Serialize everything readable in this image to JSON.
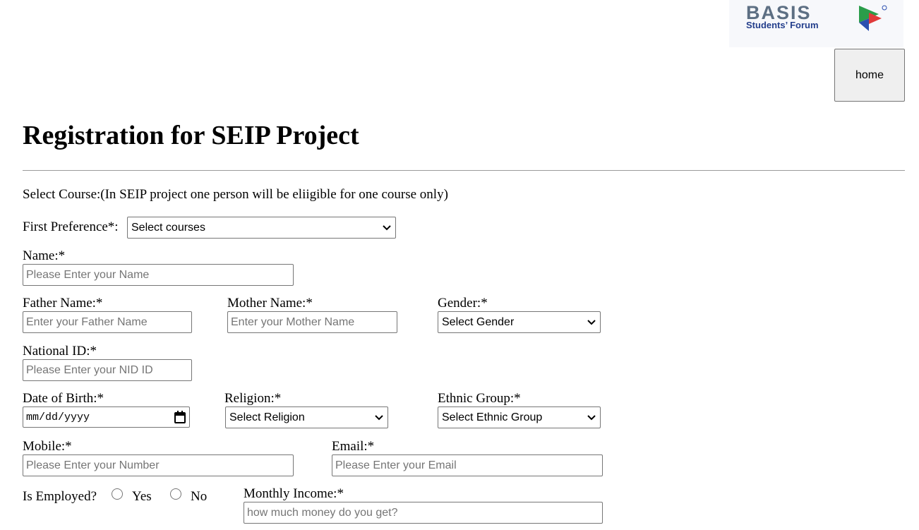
{
  "logo": {
    "title": "BASIS",
    "subtitle": "Students’ Forum"
  },
  "header": {
    "home_label": "home"
  },
  "page": {
    "title": "Registration for SEIP Project",
    "course_note": "Select Course:(In SEIP project one person will be eliigible for one course only)"
  },
  "form": {
    "first_preference": {
      "label": "First Preference*:",
      "selected": "Select courses"
    },
    "name": {
      "label": "Name:*",
      "placeholder": "Please Enter your Name"
    },
    "father_name": {
      "label": "Father Name:*",
      "placeholder": "Enter your Father Name"
    },
    "mother_name": {
      "label": "Mother Name:*",
      "placeholder": "Enter your Mother Name"
    },
    "gender": {
      "label": "Gender:*",
      "selected": "Select Gender"
    },
    "national_id": {
      "label": "National ID:*",
      "placeholder": "Please Enter your NID ID"
    },
    "dob": {
      "label": "Date of Birth:*",
      "value": "mm/dd/yyyy"
    },
    "religion": {
      "label": "Religion:*",
      "selected": "Select Religion"
    },
    "ethnic_group": {
      "label": "Ethnic Group:*",
      "selected": "Select Ethnic Group"
    },
    "mobile": {
      "label": "Mobile:*",
      "placeholder": "Please Enter your Number"
    },
    "email": {
      "label": "Email:*",
      "placeholder": "Please Enter your Email"
    },
    "employed": {
      "label": "Is Employed?",
      "yes_label": "Yes",
      "no_label": "No"
    },
    "monthly_income": {
      "label": "Monthly Income:*",
      "placeholder": "how much money do you get?"
    }
  }
}
